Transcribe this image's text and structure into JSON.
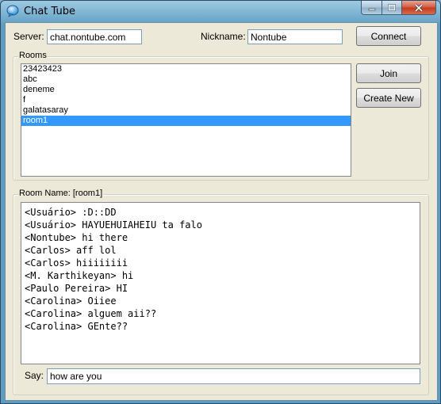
{
  "window": {
    "title": "Chat Tube"
  },
  "connection": {
    "server_label": "Server:",
    "server_value": "chat.nontube.com",
    "nickname_label": "Nickname:",
    "nickname_value": "Nontube",
    "connect_label": "Connect"
  },
  "rooms": {
    "group_label": "Rooms",
    "items": [
      {
        "label": "23423423",
        "selected": false
      },
      {
        "label": "abc",
        "selected": false
      },
      {
        "label": "deneme",
        "selected": false
      },
      {
        "label": "f",
        "selected": false
      },
      {
        "label": "galatasaray",
        "selected": false
      },
      {
        "label": "room1",
        "selected": true
      }
    ],
    "join_label": "Join",
    "create_label": "Create New"
  },
  "room": {
    "group_label": "Room Name: [room1]",
    "messages": [
      "<Usuário> :D::DD",
      "<Usuário> HAYUEHUIAHEIU ta falo",
      "<Nontube> hi there",
      "<Carlos> aff lol",
      "<Carlos> hiiiiiiii",
      "<M. Karthikeyan> hi",
      "<Paulo Pereira> HI",
      "<Carolina> Oiiee",
      "<Carolina> alguem aii??",
      "<Carolina> GEnte??"
    ],
    "say_label": "Say:",
    "say_value": "how are you"
  }
}
